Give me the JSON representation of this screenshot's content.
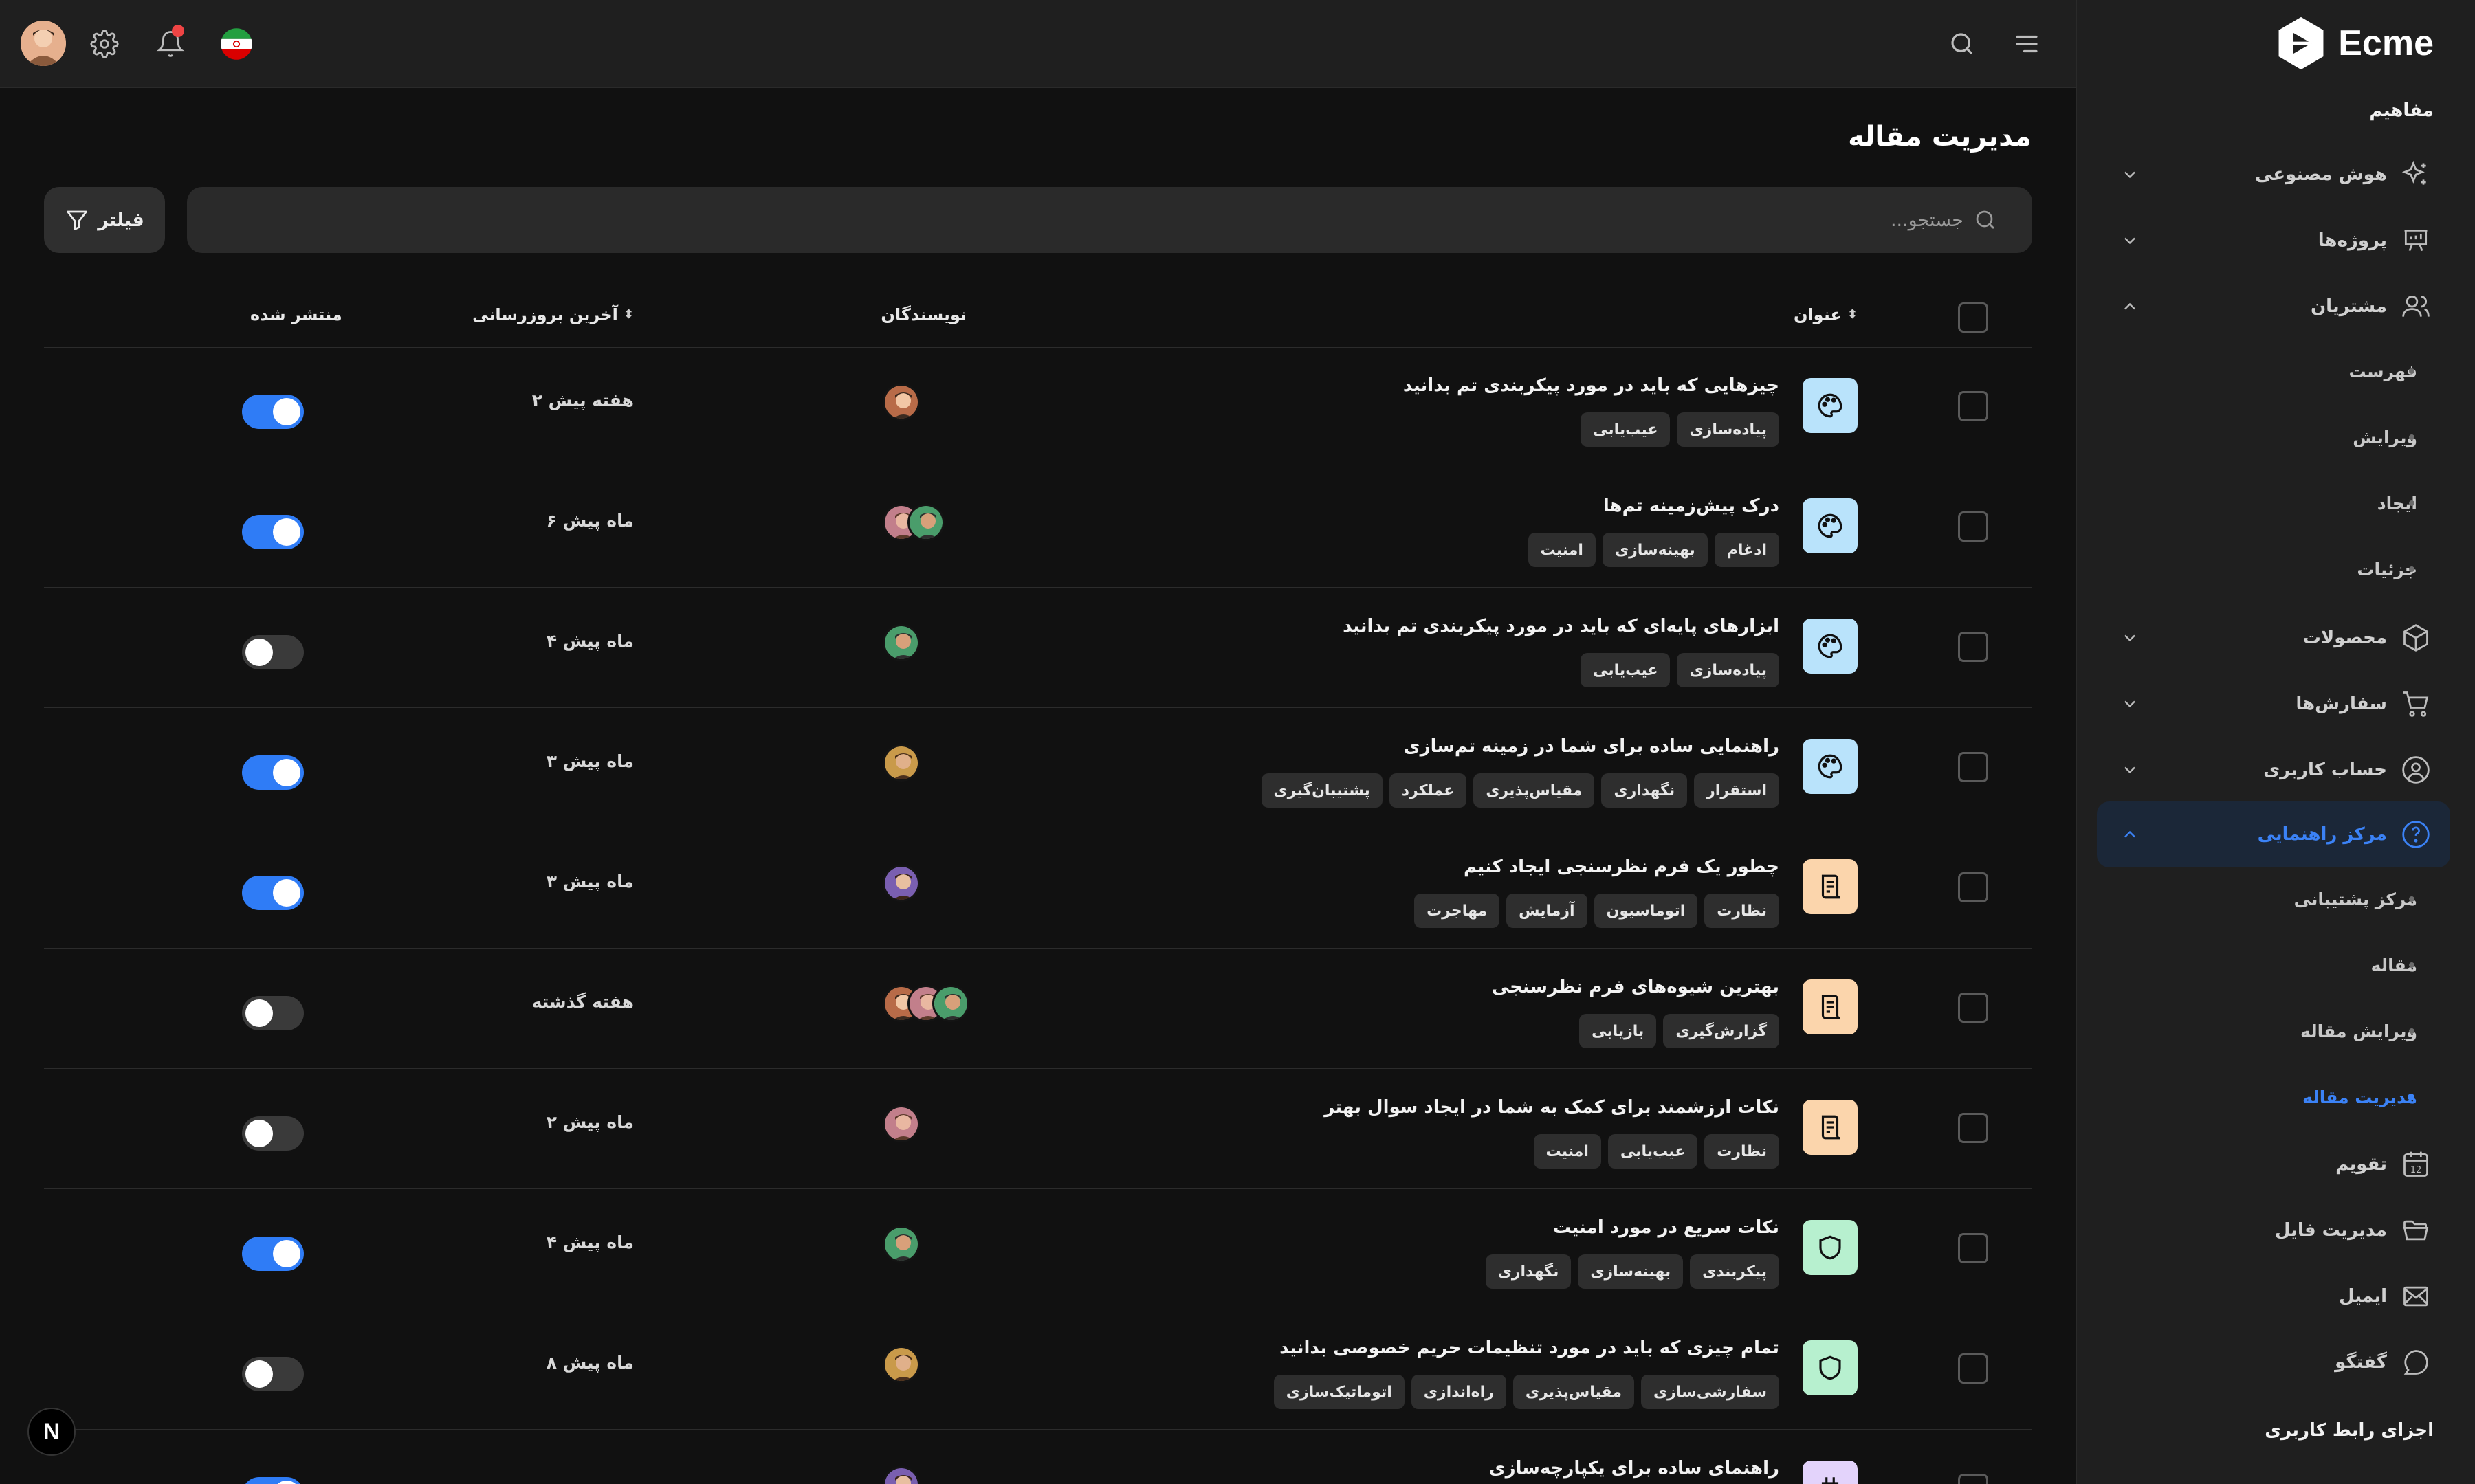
{
  "app": {
    "brand": "Ecme"
  },
  "sidebar": {
    "section": "مفاهیم",
    "items": [
      {
        "label": "هوش مصنوعی",
        "icon": "sparkle-icon",
        "chevron": "down"
      },
      {
        "label": "پروژه‌ها",
        "icon": "presentation-board-icon",
        "chevron": "down"
      },
      {
        "label": "مشتریان",
        "icon": "users-icon",
        "chevron": "up"
      },
      {
        "label": "محصولات",
        "icon": "box-icon",
        "chevron": "down"
      },
      {
        "label": "سفارش‌ها",
        "icon": "cart-icon",
        "chevron": "down"
      },
      {
        "label": "حساب کاربری",
        "icon": "user-circle-icon",
        "chevron": "down"
      },
      {
        "label": "مرکز راهنمایی",
        "icon": "help-circle-icon",
        "chevron": "up"
      },
      {
        "label": "تقویم",
        "icon": "calendar-icon"
      },
      {
        "label": "مدیریت فایل",
        "icon": "folder-icon"
      },
      {
        "label": "ایمیل",
        "icon": "mail-icon"
      },
      {
        "label": "گفتگو",
        "icon": "chat-icon"
      }
    ],
    "customers_sub": [
      "فهرست",
      "ویرایش",
      "ایجاد",
      "جزئیات"
    ],
    "help_sub": [
      "مرکز پشتیبانی",
      "مقاله",
      "ویرایش مقاله",
      "مدیریت مقاله"
    ],
    "active_sub": "مدیریت مقاله",
    "next_section": "اجزای رابط کاربری",
    "calendar_day": "12"
  },
  "topbar": {
    "icons": [
      "avatar",
      "gear-icon",
      "bell-icon",
      "iran-flag-icon",
      "search-icon",
      "menu-icon"
    ]
  },
  "page": {
    "title": "مدیریت مقاله",
    "search_placeholder": "جستجو...",
    "filter_label": "فیلتر"
  },
  "table": {
    "headers": {
      "title": "عنوان",
      "authors": "نویسندگان",
      "updated": "آخرین بروزرسانی",
      "published": "منتشر شده"
    },
    "rows": [
      {
        "title": "چیزهایی که باید در مورد پیکربندی تم بدانید",
        "icon": "palette-icon",
        "icon_bg": "#b9e3fb",
        "tags": [
          "پیاده‌سازی",
          "عیب‌یابی"
        ],
        "authors": 1,
        "updated": "۲ هفته پیش",
        "published": true
      },
      {
        "title": "درک پیش‌زمینه تم‌ها",
        "icon": "palette-icon",
        "icon_bg": "#b9e3fb",
        "tags": [
          "ادغام",
          "بهینه‌سازی",
          "امنیت"
        ],
        "authors": 2,
        "updated": "۶ ماه پیش",
        "published": true
      },
      {
        "title": "ابزارهای پایه‌ای که باید در مورد پیکربندی تم بدانید",
        "icon": "palette-icon",
        "icon_bg": "#b9e3fb",
        "tags": [
          "پیاده‌سازی",
          "عیب‌یابی"
        ],
        "authors": 1,
        "updated": "۴ ماه پیش",
        "published": false
      },
      {
        "title": "راهنمایی ساده برای شما در زمینه تم‌سازی",
        "icon": "palette-icon",
        "icon_bg": "#b9e3fb",
        "tags": [
          "استقرار",
          "نگهداری",
          "مقیاس‌پذیری",
          "عملکرد",
          "پشتیبان‌گیری"
        ],
        "authors": 1,
        "updated": "۳ ماه پیش",
        "published": true
      },
      {
        "title": "چطور یک فرم نظرسنجی ایجاد کنیم",
        "icon": "survey-icon",
        "icon_bg": "#fbd5ac",
        "tags": [
          "نظارت",
          "اتوماسیون",
          "آزمایش",
          "مهاجرت"
        ],
        "authors": 1,
        "updated": "۳ ماه پیش",
        "published": true
      },
      {
        "title": "بهترین شیوه‌های فرم نظرسنجی",
        "icon": "survey-icon",
        "icon_bg": "#fbd5ac",
        "tags": [
          "گزارش‌گیری",
          "بازیابی"
        ],
        "authors": 3,
        "updated": "هفته گذشته",
        "published": false
      },
      {
        "title": "نکات ارزشمند برای کمک به شما در ایجاد سوال بهتر",
        "icon": "survey-icon",
        "icon_bg": "#fbd5ac",
        "tags": [
          "نظارت",
          "عیب‌یابی",
          "امنیت"
        ],
        "authors": 1,
        "updated": "۲ ماه پیش",
        "published": false
      },
      {
        "title": "نکات سریع در مورد امنیت",
        "icon": "shield-icon",
        "icon_bg": "#b7f0cf",
        "tags": [
          "پیکربندی",
          "بهینه‌سازی",
          "نگهداری"
        ],
        "authors": 1,
        "updated": "۴ ماه پیش",
        "published": true
      },
      {
        "title": "تمام چیزی که باید در مورد تنظیمات حریم خصوصی بدانید",
        "icon": "shield-icon",
        "icon_bg": "#b7f0cf",
        "tags": [
          "سفارشی‌سازی",
          "مقیاس‌پذیری",
          "راه‌اندازی",
          "اتوماتیک‌سازی"
        ],
        "authors": 1,
        "updated": "۸ ماه پیش",
        "published": false
      },
      {
        "title": "راهنمای ساده برای یکپارچه‌سازی",
        "icon": "plug-icon",
        "icon_bg": "#e3d3fb",
        "tags": [],
        "authors": 1,
        "updated": "",
        "published": true
      }
    ]
  },
  "badge": {
    "label": "N"
  }
}
